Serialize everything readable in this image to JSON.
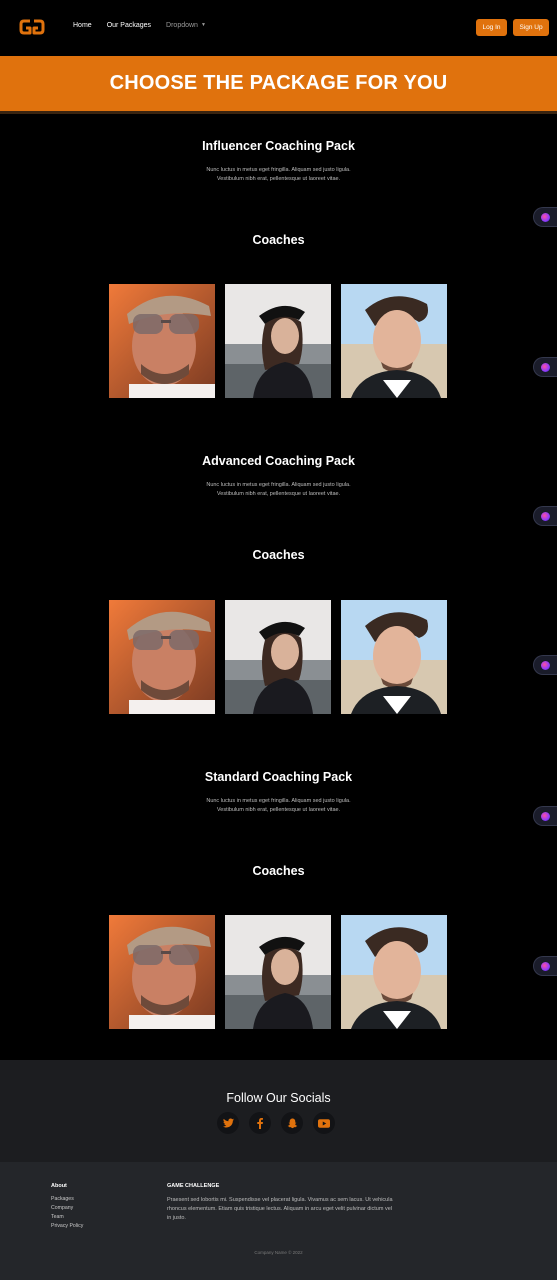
{
  "nav": {
    "links": [
      "Home",
      "Our Packages",
      "Dropdown"
    ],
    "login": "Log In",
    "signup": "Sign Up"
  },
  "banner": {
    "title": "CHOOSE THE PACKAGE FOR YOU"
  },
  "packs": [
    {
      "title": "Influencer Coaching Pack",
      "desc_line1": "Nunc luctus in metus eget fringilla. Aliquam sed justo ligula.",
      "desc_line2": "Vestibulum nibh erat, pellentesque ut laoreet vitae.",
      "coaches_label": "Coaches"
    },
    {
      "title": "Advanced Coaching Pack",
      "desc_line1": "Nunc luctus in metus eget fringilla. Aliquam sed justo ligula.",
      "desc_line2": "Vestibulum nibh erat, pellentesque ut laoreet vitae.",
      "coaches_label": "Coaches"
    },
    {
      "title": "Standard Coaching Pack",
      "desc_line1": "Nunc luctus in metus eget fringilla. Aliquam sed justo ligula.",
      "desc_line2": "Vestibulum nibh erat, pellentesque ut laoreet vitae.",
      "coaches_label": "Coaches"
    }
  ],
  "socials": {
    "title": "Follow Our Socials",
    "icons": [
      "twitter-icon",
      "facebook-icon",
      "snapchat-icon",
      "youtube-icon"
    ]
  },
  "footer": {
    "about_heading": "About",
    "links": [
      "Packages",
      "Company",
      "Team",
      "Privacy Policy"
    ],
    "brand_heading": "GAME CHALLENGE",
    "brand_text": "Praesent sed lobortis mi. Suspendisse vel placerat ligula. Vivamus ac sem lacus. Ut vehicula rhoncus elementum. Etiam quis tristique lectus. Aliquam in arcu eget velit pulvinar dictum vel in justo.",
    "copyright": "Company Name © 2022"
  },
  "colors": {
    "accent": "#e0720d",
    "background": "#000000",
    "footer": "#24262a",
    "socials": "#1c1d20"
  }
}
